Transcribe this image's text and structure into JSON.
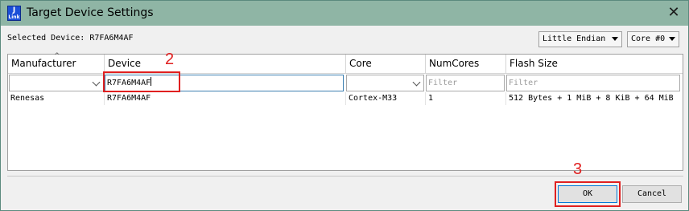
{
  "window": {
    "title": "Target Device Settings",
    "app_icon_text": "J",
    "app_icon_subtext": "Link",
    "close_glyph": "✕"
  },
  "toolbar": {
    "selected_device_label": "Selected Device: R7FA6M4AF",
    "endian_select": "Little Endian",
    "core_select": "Core #0"
  },
  "table": {
    "columns": [
      "Manufacturer",
      "Device",
      "Core",
      "NumCores",
      "Flash Size"
    ],
    "filters": {
      "manufacturer": "",
      "device": "R7FA6M4AF",
      "core": "",
      "numcores_placeholder": "Filter",
      "flash_placeholder": "Filter"
    },
    "rows": [
      {
        "manufacturer": "Renesas",
        "device": "R7FA6M4AF",
        "core": "Cortex-M33",
        "numcores": "1",
        "flash": "512 Bytes + 1 MiB + 8 KiB + 64 MiB"
      }
    ]
  },
  "buttons": {
    "ok": "OK",
    "cancel": "Cancel"
  },
  "annotations": {
    "step2": "2",
    "step3": "3",
    "color": "#e02020"
  },
  "colors": {
    "titlebar": "#8fb5a5",
    "focus_border": "#0078d7"
  }
}
